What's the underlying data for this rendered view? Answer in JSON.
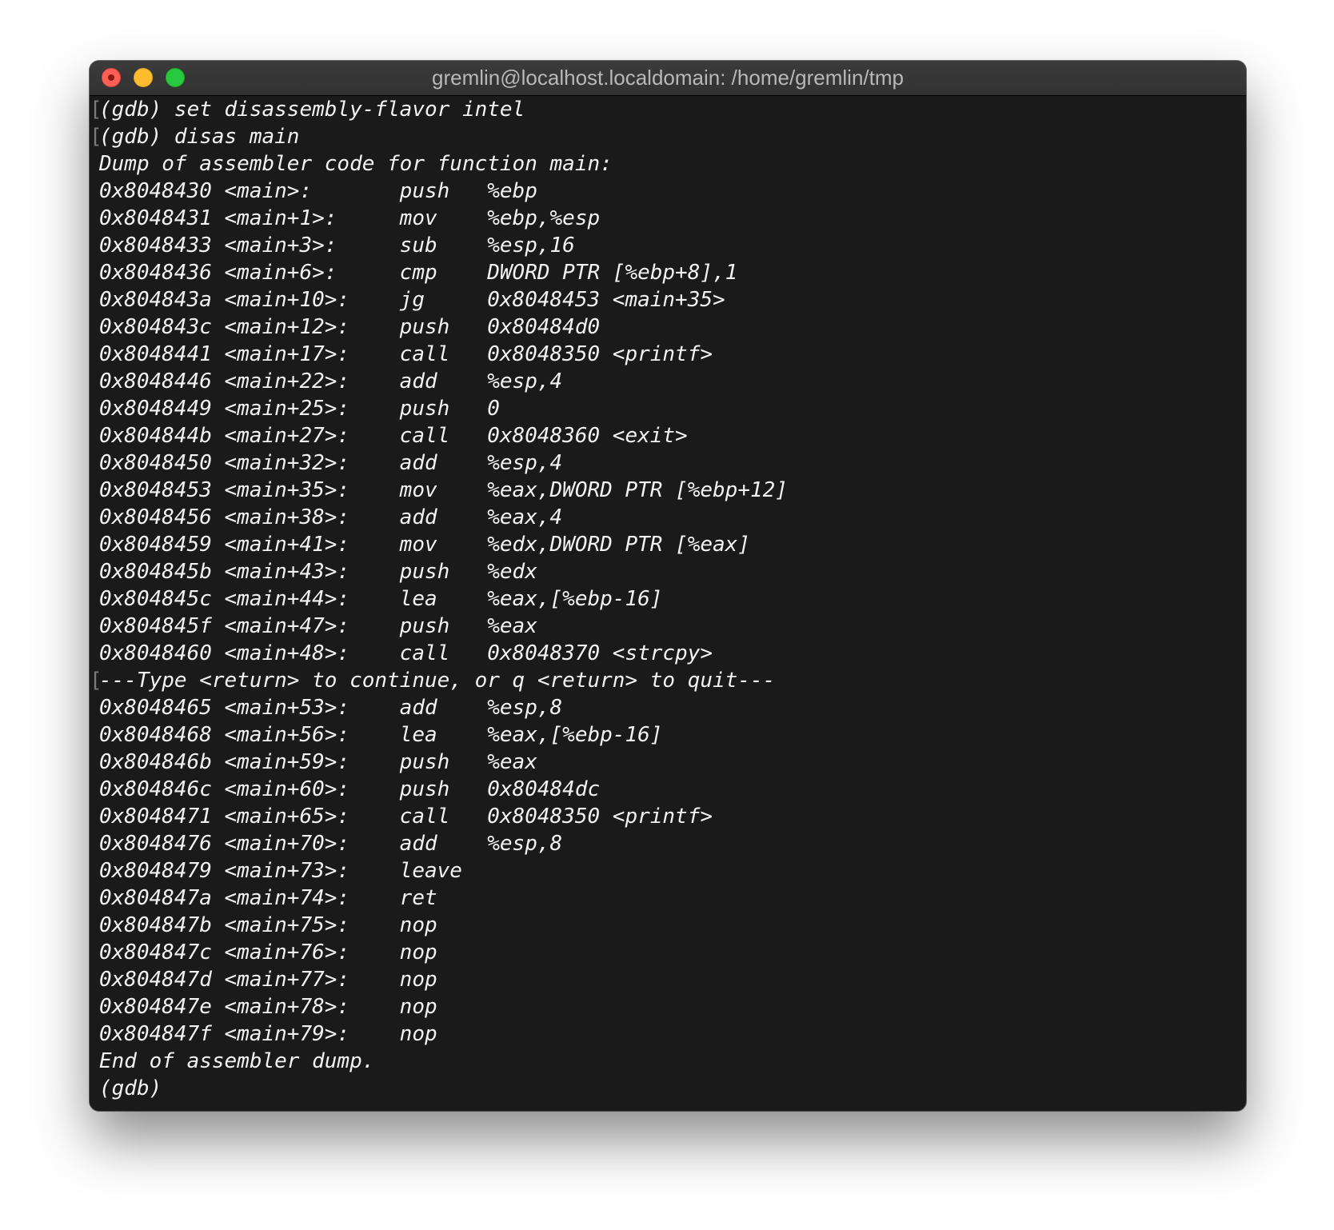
{
  "window": {
    "title": "gremlin@localhost.localdomain: /home/gremlin/tmp"
  },
  "terminal": {
    "lines": [
      "(gdb) set disassembly-flavor intel",
      "(gdb) disas main",
      "Dump of assembler code for function main:",
      "0x8048430 <main>:       push   %ebp",
      "0x8048431 <main+1>:     mov    %ebp,%esp",
      "0x8048433 <main+3>:     sub    %esp,16",
      "0x8048436 <main+6>:     cmp    DWORD PTR [%ebp+8],1",
      "0x804843a <main+10>:    jg     0x8048453 <main+35>",
      "0x804843c <main+12>:    push   0x80484d0",
      "0x8048441 <main+17>:    call   0x8048350 <printf>",
      "0x8048446 <main+22>:    add    %esp,4",
      "0x8048449 <main+25>:    push   0",
      "0x804844b <main+27>:    call   0x8048360 <exit>",
      "0x8048450 <main+32>:    add    %esp,4",
      "0x8048453 <main+35>:    mov    %eax,DWORD PTR [%ebp+12]",
      "0x8048456 <main+38>:    add    %eax,4",
      "0x8048459 <main+41>:    mov    %edx,DWORD PTR [%eax]",
      "0x804845b <main+43>:    push   %edx",
      "0x804845c <main+44>:    lea    %eax,[%ebp-16]",
      "0x804845f <main+47>:    push   %eax",
      "0x8048460 <main+48>:    call   0x8048370 <strcpy>",
      "---Type <return> to continue, or q <return> to quit---",
      "0x8048465 <main+53>:    add    %esp,8",
      "0x8048468 <main+56>:    lea    %eax,[%ebp-16]",
      "0x804846b <main+59>:    push   %eax",
      "0x804846c <main+60>:    push   0x80484dc",
      "0x8048471 <main+65>:    call   0x8048350 <printf>",
      "0x8048476 <main+70>:    add    %esp,8",
      "0x8048479 <main+73>:    leave",
      "0x804847a <main+74>:    ret",
      "0x804847b <main+75>:    nop",
      "0x804847c <main+76>:    nop",
      "0x804847d <main+77>:    nop",
      "0x804847e <main+78>:    nop",
      "0x804847f <main+79>:    nop",
      "End of assembler dump.",
      "(gdb)"
    ]
  },
  "colors": {
    "background": "#1a1a1a",
    "text": "#f2f2f2",
    "titlebar": "#353535",
    "close": "#fe5f57",
    "minimize": "#febc2e",
    "maximize": "#28c840"
  }
}
